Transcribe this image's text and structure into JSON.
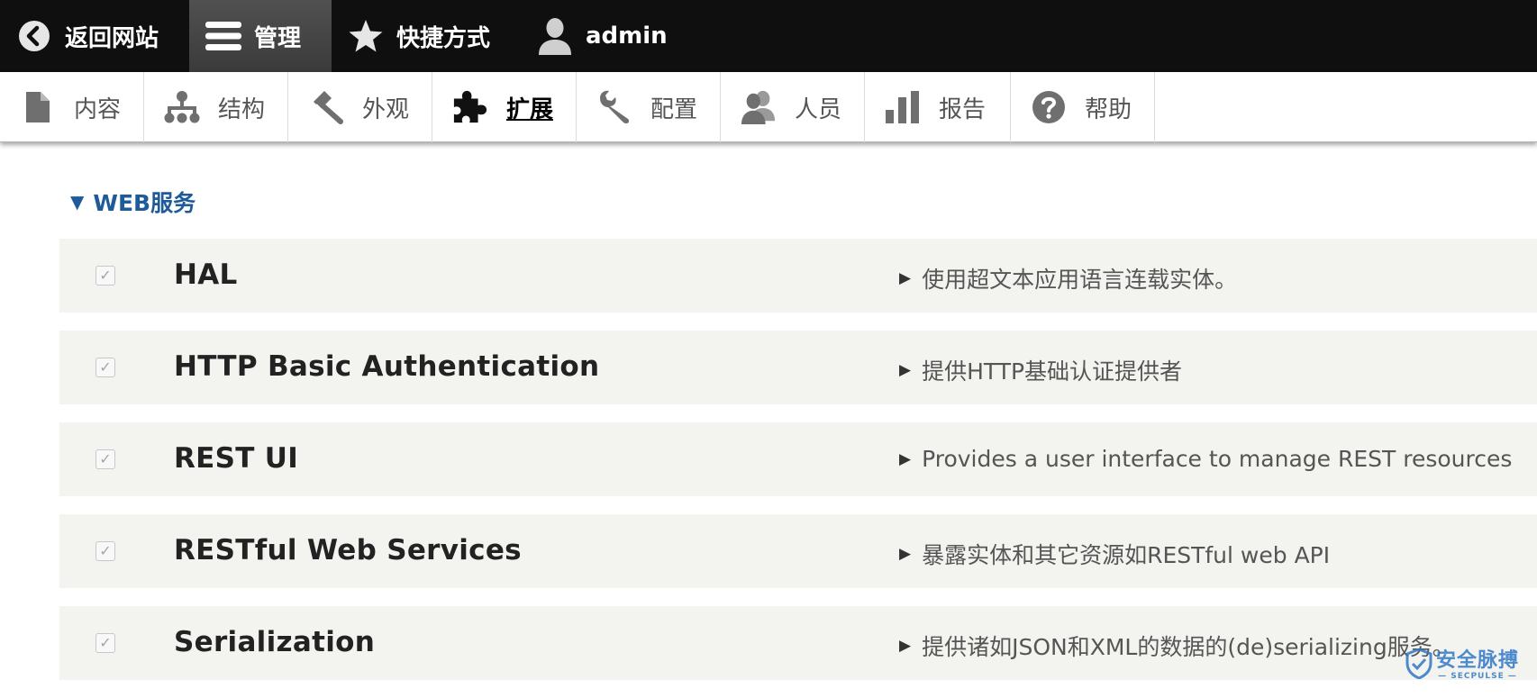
{
  "toolbar": {
    "items": [
      {
        "label": "返回网站",
        "icon": "chevron-left-circle-icon"
      },
      {
        "label": "管理",
        "icon": "hamburger-menu-icon",
        "active": true
      },
      {
        "label": "快捷方式",
        "icon": "star-icon"
      },
      {
        "label": "admin",
        "icon": "user-icon"
      }
    ]
  },
  "tray": {
    "items": [
      {
        "label": "内容",
        "icon": "file-icon"
      },
      {
        "label": "结构",
        "icon": "sitemap-icon"
      },
      {
        "label": "外观",
        "icon": "paintbrush-icon"
      },
      {
        "label": "扩展",
        "icon": "puzzle-icon",
        "active": true
      },
      {
        "label": "配置",
        "icon": "wrench-icon"
      },
      {
        "label": "人员",
        "icon": "people-icon"
      },
      {
        "label": "报告",
        "icon": "bar-chart-icon"
      },
      {
        "label": "帮助",
        "icon": "question-circle-icon"
      }
    ]
  },
  "section": {
    "title": "WEB服务",
    "expanded": true
  },
  "modules": [
    {
      "name": "HAL",
      "description": "使用超文本应用语言连载实体。",
      "checked": true
    },
    {
      "name": "HTTP Basic Authentication",
      "description": "提供HTTP基础认证提供者",
      "checked": true
    },
    {
      "name": "REST UI",
      "description": "Provides a user interface to manage REST resources",
      "checked": true
    },
    {
      "name": "RESTful Web Services",
      "description": "暴露实体和其它资源如RESTful web API",
      "checked": true
    },
    {
      "name": "Serialization",
      "description": "提供诸如JSON和XML的数据的(de)serializing服务。",
      "checked": true
    }
  ],
  "watermark": {
    "title": "安全脉搏",
    "subtitle": "— SECPULSE —"
  },
  "colors": {
    "toolbar_bg": "#0f0f0f",
    "section_link": "#1f5b99",
    "row_bg": "#f3f3ef",
    "watermark": "#2f78c8"
  }
}
